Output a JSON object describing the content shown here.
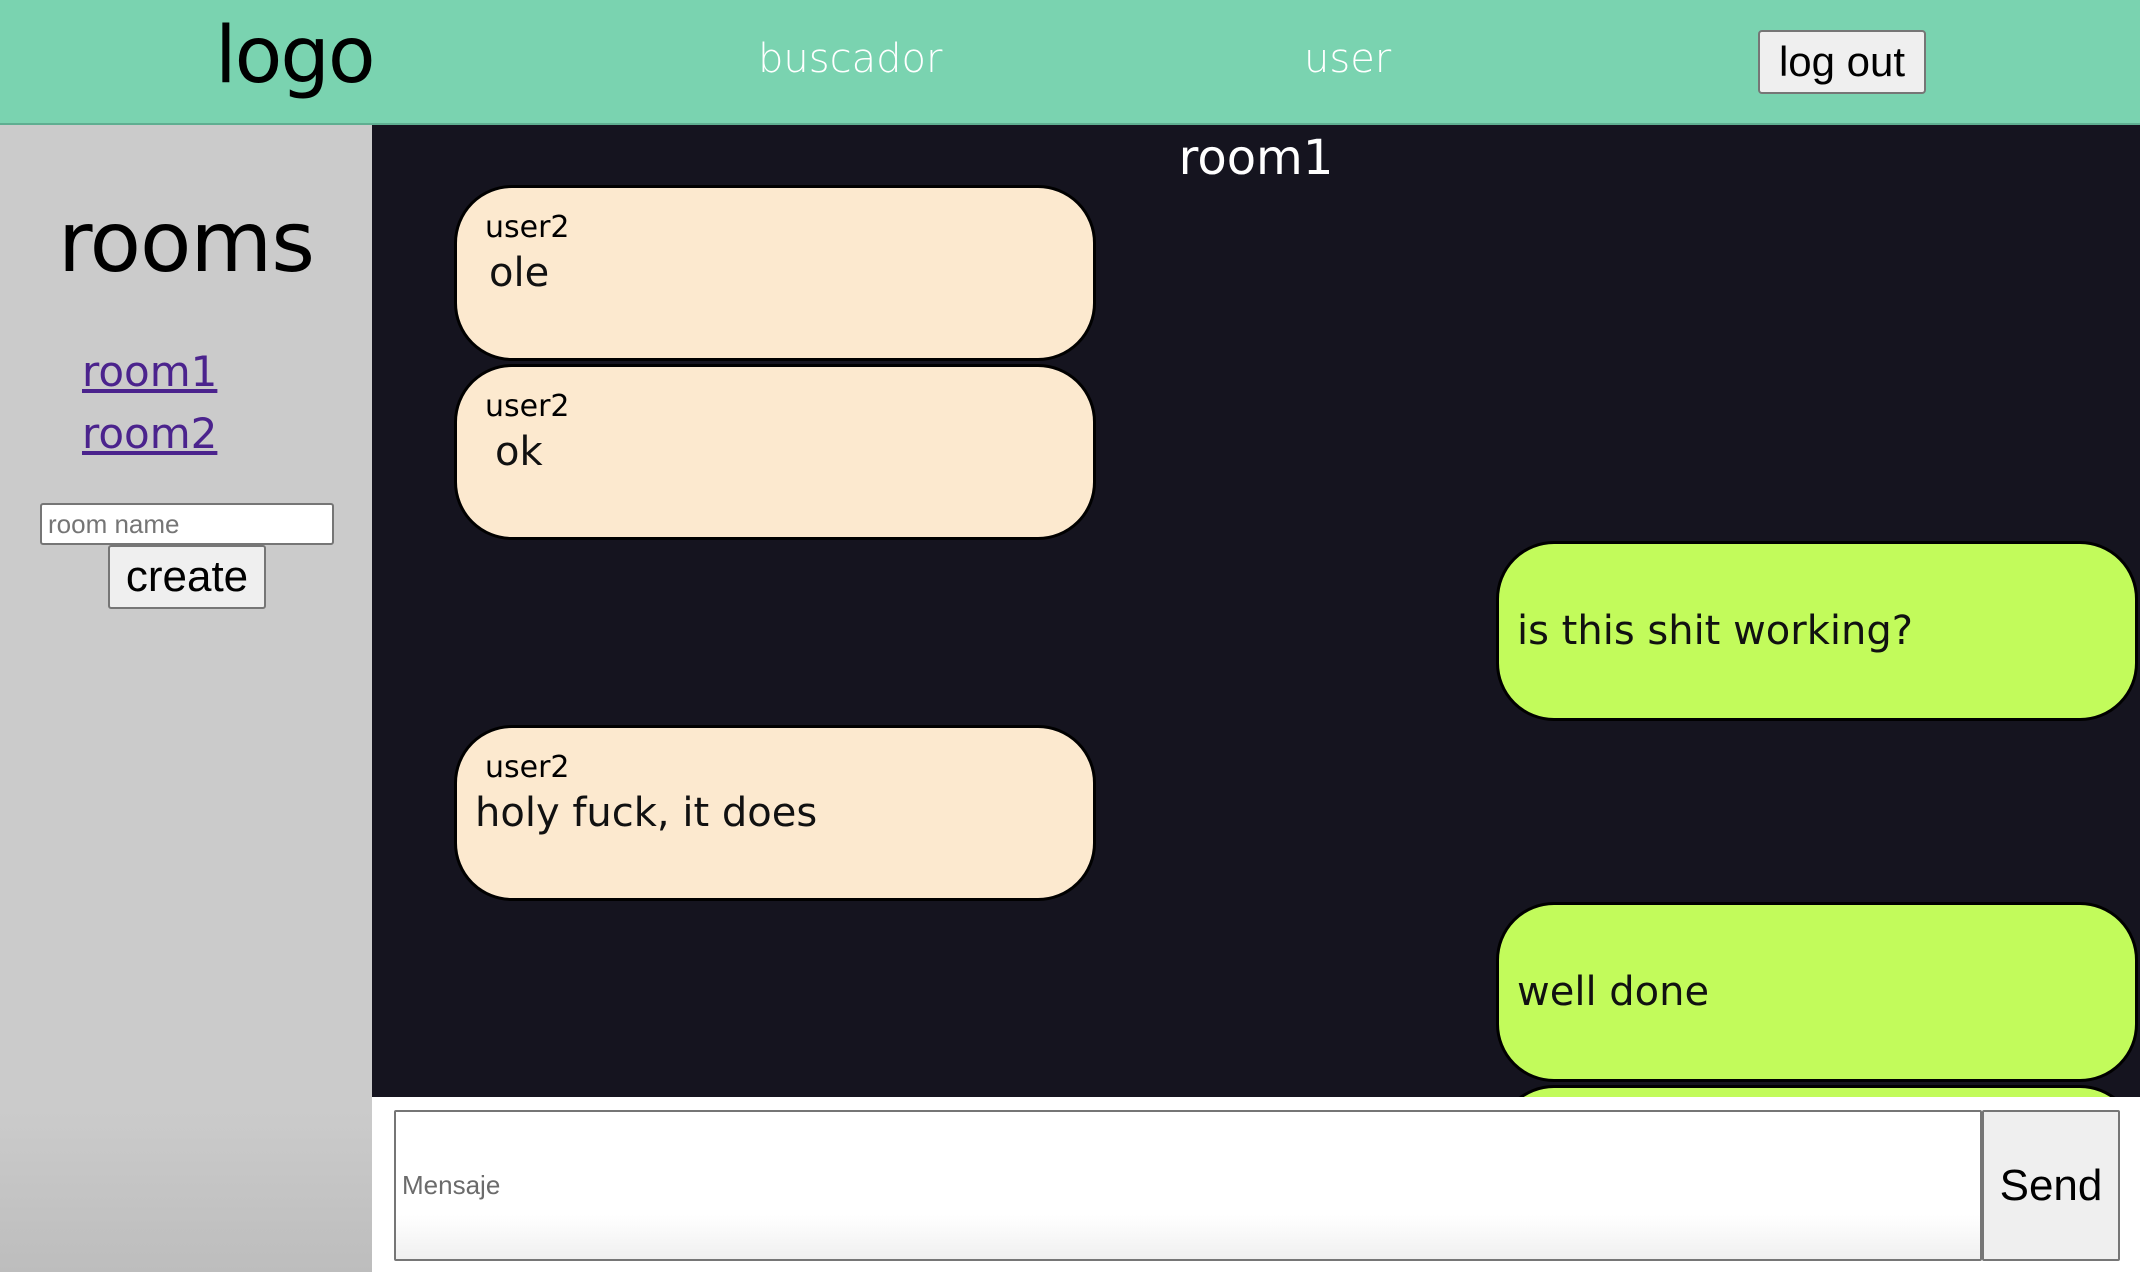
{
  "header": {
    "logo": "logo",
    "nav": [
      "buscador",
      "user"
    ],
    "logout_label": "log out"
  },
  "sidebar": {
    "title": "rooms",
    "rooms": [
      "room1",
      "room2"
    ],
    "room_name_placeholder": "room name",
    "create_label": "create"
  },
  "chat": {
    "room_title": "room1",
    "messages": [
      {
        "sender": "user2",
        "text": "ole",
        "mine": false
      },
      {
        "sender": "user2",
        "text": "ok",
        "mine": false
      },
      {
        "sender": "",
        "text": "is this shit working?",
        "mine": true
      },
      {
        "sender": "user2",
        "text": "holy fuck, it does",
        "mine": false
      },
      {
        "sender": "",
        "text": "well done",
        "mine": true
      },
      {
        "sender": "",
        "text": "",
        "mine": true
      }
    ]
  },
  "composer": {
    "placeholder": "Mensaje",
    "send_label": "Send"
  },
  "colors": {
    "header_bg": "#7ad3b0",
    "sidebar_bg": "#cbcbcb",
    "chat_bg": "#15141f",
    "incoming_bubble": "#fce9cf",
    "outgoing_bubble": "#c2fb5b",
    "room_link": "#4b238d"
  }
}
